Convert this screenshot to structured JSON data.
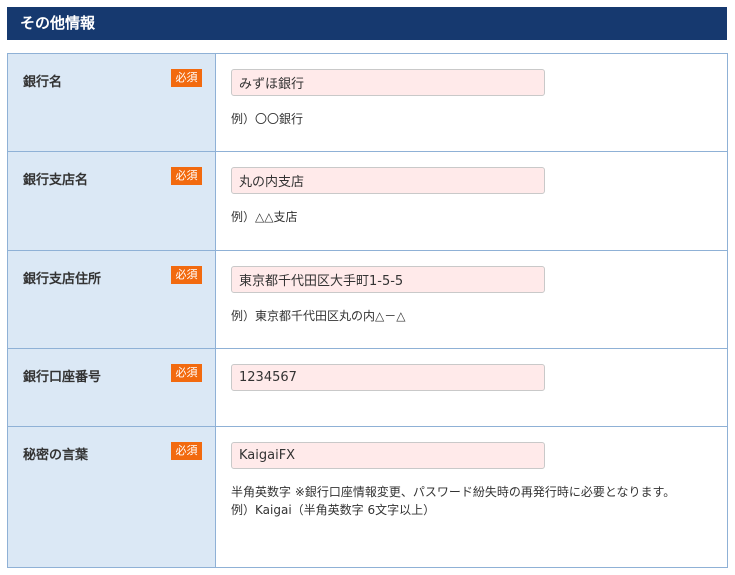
{
  "section": {
    "title": "その他情報"
  },
  "required_label": "必須",
  "rows": [
    {
      "label": "銀行名",
      "value": "みずほ銀行",
      "example": "例）〇〇銀行"
    },
    {
      "label": "銀行支店名",
      "value": "丸の内支店",
      "example": "例）△△支店"
    },
    {
      "label": "銀行支店住所",
      "value": "東京都千代田区大手町1-5-5",
      "example": "例）東京都千代田区丸の内△－△"
    },
    {
      "label": "銀行口座番号",
      "value": "1234567"
    },
    {
      "label": "秘密の言葉",
      "value": "KaigaiFX",
      "note": "半角英数字 ※銀行口座情報変更、パスワード紛失時の再発行時に必要となります。",
      "example": "例）Kaigai（半角英数字 6文字以上）"
    }
  ]
}
